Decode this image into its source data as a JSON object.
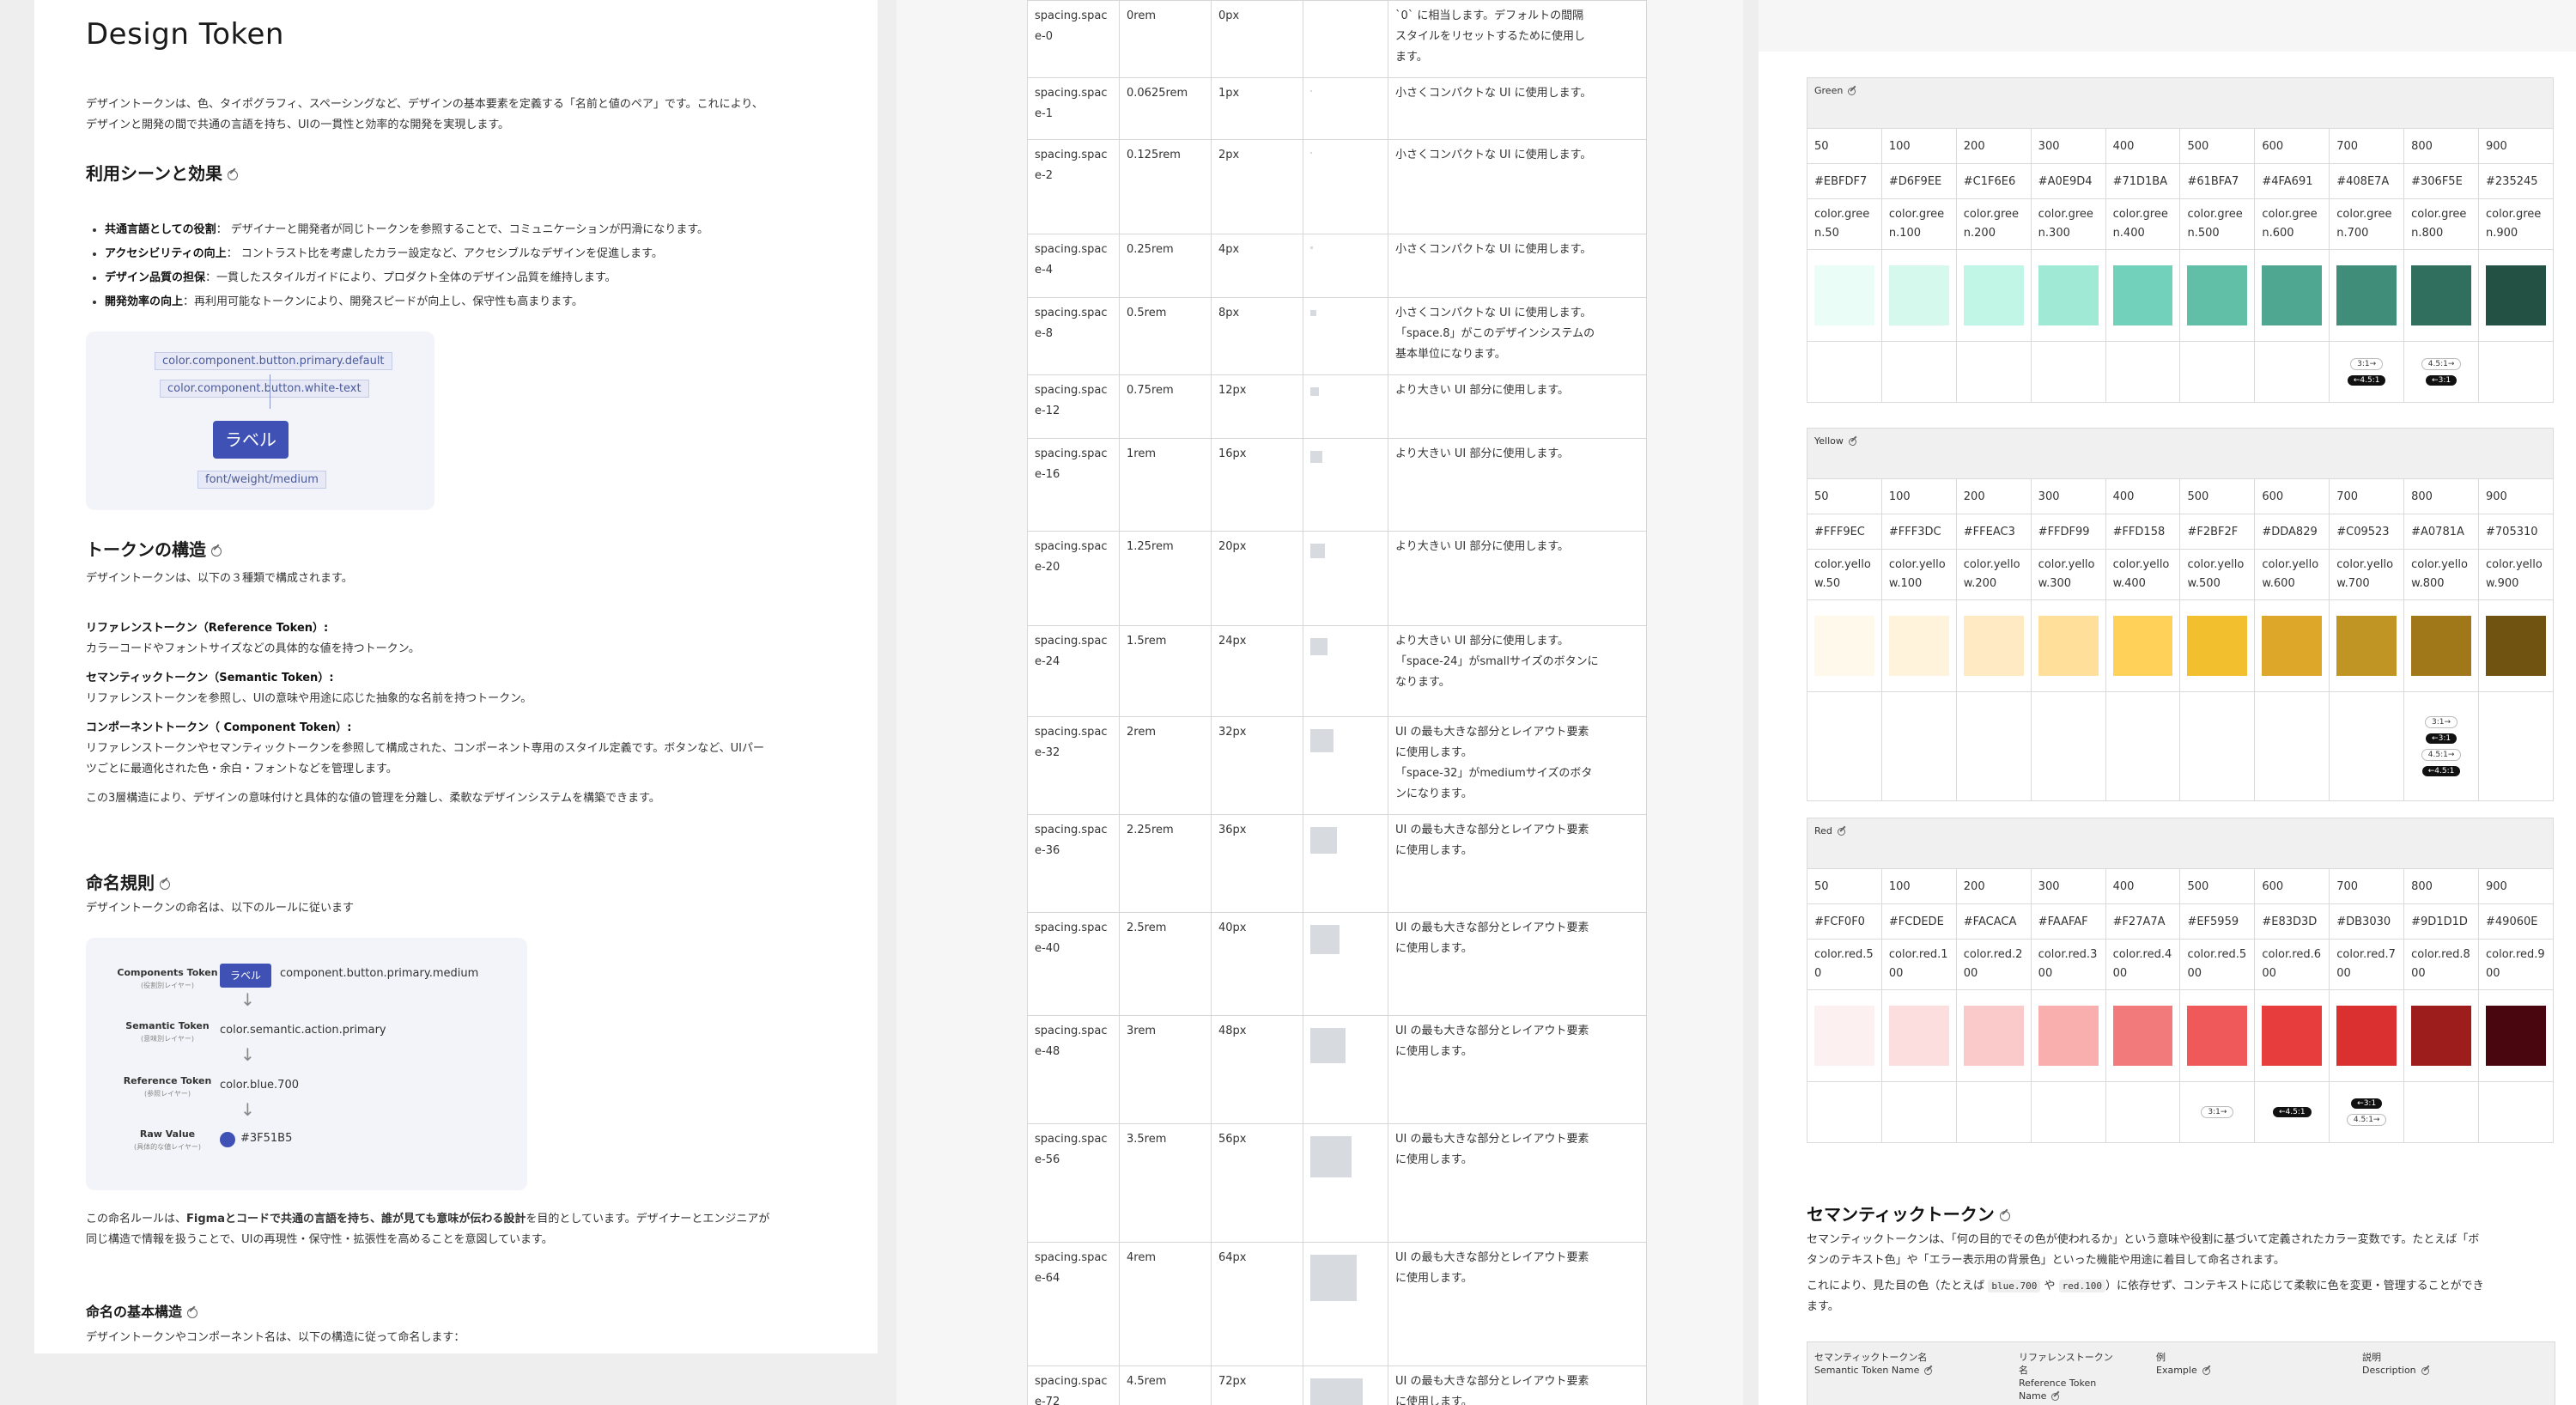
{
  "left": {
    "title": "Design Token",
    "intro_1": "デザイントークンは、色、タイポグラフィ、スペーシングなど、デザインの基本要素を定義する「名前と値のペア」です。これにより、",
    "intro_2": "デザインと開発の間で共通の言語を持ち、UIの一貫性と効率的な開発を実現します。",
    "use_heading": "利用シーンと効果",
    "bullets": [
      {
        "bold": "共通言語としての役割",
        "text": "： デザイナーと開発者が同じトークンを参照することで、コミュニケーションが円滑になります。"
      },
      {
        "bold": "アクセシビリティの向上",
        "text": "： コントラスト比を考慮したカラー設定など、アクセシブルなデザインを促進します。"
      },
      {
        "bold": "デザイン品質の担保",
        "text": "：一貫したスタイルガイドにより、プロダクト全体のデザイン品質を維持します。"
      },
      {
        "bold": "開発効率の向上",
        "text": "：再利用可能なトークンにより、開発スピードが向上し、保守性も高まります。"
      }
    ],
    "fig1": {
      "chip_top": "color.component.button.primary.default",
      "chip_mid": "color.component.button.white-text",
      "button": "ラベル",
      "chip_bottom": "font/weight/medium"
    },
    "structure_heading": "トークンの構造",
    "structure_intro": "デザイントークンは、以下の３種類で構成されます。",
    "ref_term": "リファレンストークン（Reference Token）:",
    "ref_desc": "カラーコードやフォントサイズなどの具体的な値を持つトークン。",
    "sem_term": "セマンティックトークン（Semantic Token）:",
    "sem_desc": "リファレンストークンを参照し、UIの意味や用途に応じた抽象的な名前を持つトークン。",
    "comp_term": "コンポーネントトークン（ Component Token）:",
    "comp_desc_1": "リファレンストークンやセマンティックトークンを参照して構成された、コンポーネント専用のスタイル定義です。ボタンなど、UIパー",
    "comp_desc_2": "ツごとに最適化された色・余白・フォントなどを管理します。",
    "structure_summary": "この3層構造により、デザインの意味付けと具体的な値の管理を分離し、柔軟なデザインシステムを構築できます。",
    "naming_heading": "命名規則",
    "naming_intro": "デザイントークンの命名は、以下のルールに従います",
    "flow": [
      {
        "name": "Components Token",
        "sub": "(役割別レイヤー)",
        "value": "component.button.primary.medium",
        "button": "ラベル"
      },
      {
        "name": "Semantic Token",
        "sub": "(意味別レイヤー)",
        "value": "color.semantic.action.primary"
      },
      {
        "name": "Reference Token",
        "sub": "(参照レイヤー)",
        "value": "color.blue.700"
      },
      {
        "name": "Raw Value",
        "sub": "(具体的な値レイヤー)",
        "value": "#3F51B5"
      }
    ],
    "naming_p1_a": "この命名ルールは、",
    "naming_p1_b": "Figmaとコードで共通の言語を持ち、誰が見ても意味が伝わる設計",
    "naming_p1_c": "を目的としています。デザイナーとエンジニアが",
    "naming_p2": "同じ構造で情報を扱うことで、UIの再現性・保守性・拡張性を高めることを意図しています。",
    "basic_heading": "命名の基本構造",
    "basic_intro": "デザイントークンやコンポーネント名は、以下の構造に従って命名します："
  },
  "spacing": {
    "rows": [
      {
        "name": "spacing.space-0",
        "rem": "0rem",
        "px": "0px",
        "swatch": 0,
        "desc": [
          "`0` に相当します。デフォルトの間隔",
          "スタイルをリセットするために使用し",
          "ます。"
        ]
      },
      {
        "name": "spacing.space-1",
        "rem": "0.0625rem",
        "px": "1px",
        "swatch": 1,
        "desc": [
          "小さくコンパクトな UI に使用します。"
        ]
      },
      {
        "name": "spacing.space-2",
        "rem": "0.125rem",
        "px": "2px",
        "swatch": 2,
        "desc": [
          "小さくコンパクトな UI に使用します。"
        ]
      },
      {
        "name": "spacing.space-4",
        "rem": "0.25rem",
        "px": "4px",
        "swatch": 4,
        "desc": [
          "小さくコンパクトな UI に使用します。"
        ]
      },
      {
        "name": "spacing.space-8",
        "rem": "0.5rem",
        "px": "8px",
        "swatch": 8,
        "desc": [
          "小さくコンパクトな UI に使用します。",
          "「space.8」がこのデザインシステムの",
          "基本単位になります。"
        ]
      },
      {
        "name": "spacing.space-12",
        "rem": "0.75rem",
        "px": "12px",
        "swatch": 12,
        "desc": [
          "より大きい UI 部分に使用します。"
        ]
      },
      {
        "name": "spacing.space-16",
        "rem": "1rem",
        "px": "16px",
        "swatch": 16,
        "desc": [
          "より大きい UI 部分に使用します。"
        ]
      },
      {
        "name": "spacing.space-20",
        "rem": "1.25rem",
        "px": "20px",
        "swatch": 20,
        "desc": [
          "より大きい UI 部分に使用します。"
        ]
      },
      {
        "name": "spacing.space-24",
        "rem": "1.5rem",
        "px": "24px",
        "swatch": 24,
        "desc": [
          "より大きい UI 部分に使用します。",
          "「space-24」がsmallサイズのボタンに",
          "なります。"
        ]
      },
      {
        "name": "spacing.space-32",
        "rem": "2rem",
        "px": "32px",
        "swatch": 32,
        "desc": [
          "UI の最も大きな部分とレイアウト要素",
          "に使用します。",
          "「space-32」がmediumサイズのボタ",
          "ンになります。"
        ]
      },
      {
        "name": "spacing.space-36",
        "rem": "2.25rem",
        "px": "36px",
        "swatch": 36,
        "desc": [
          "UI の最も大きな部分とレイアウト要素",
          "に使用します。"
        ]
      },
      {
        "name": "spacing.space-40",
        "rem": "2.5rem",
        "px": "40px",
        "swatch": 40,
        "desc": [
          "UI の最も大きな部分とレイアウト要素",
          "に使用します。"
        ]
      },
      {
        "name": "spacing.space-48",
        "rem": "3rem",
        "px": "48px",
        "swatch": 48,
        "desc": [
          "UI の最も大きな部分とレイアウト要素",
          "に使用します。"
        ]
      },
      {
        "name": "spacing.space-56",
        "rem": "3.5rem",
        "px": "56px",
        "swatch": 56,
        "desc": [
          "UI の最も大きな部分とレイアウト要素",
          "に使用します。"
        ]
      },
      {
        "name": "spacing.space-64",
        "rem": "4rem",
        "px": "64px",
        "swatch": 64,
        "desc": [
          "UI の最も大きな部分とレイアウト要素",
          "に使用します。"
        ]
      },
      {
        "name": "spacing.space-72",
        "rem": "4.5rem",
        "px": "72px",
        "swatch": 72,
        "desc": [
          "UI の最も大きな部分とレイアウト要素",
          "に使用します。"
        ]
      }
    ]
  },
  "palettes": [
    {
      "id": "green",
      "title": "Green",
      "steps": [
        "50",
        "100",
        "200",
        "300",
        "400",
        "500",
        "600",
        "700",
        "800",
        "900"
      ],
      "hex": [
        "#EBFDF7",
        "#D6F9EE",
        "#C1F6E6",
        "#A0E9D4",
        "#71D1BA",
        "#61BFA7",
        "#4FA691",
        "#408E7A",
        "#306F5E",
        "#235245"
      ],
      "tokens": [
        "color.green.50",
        "color.green.100",
        "color.green.200",
        "color.green.300",
        "color.green.400",
        "color.green.500",
        "color.green.600",
        "color.green.700",
        "color.green.800",
        "color.green.900"
      ],
      "badges": [
        [],
        [],
        [],
        [],
        [],
        [],
        [],
        [
          [
            "3:1→",
            "outline"
          ],
          [
            "←4.5:1",
            "filled"
          ]
        ],
        [
          [
            "4.5:1→",
            "outline"
          ],
          [
            "←3:1",
            "filled"
          ]
        ],
        []
      ]
    },
    {
      "id": "yellow",
      "title": "Yellow",
      "steps": [
        "50",
        "100",
        "200",
        "300",
        "400",
        "500",
        "600",
        "700",
        "800",
        "900"
      ],
      "hex": [
        "#FFF9EC",
        "#FFF3DC",
        "#FFEAC3",
        "#FFDF99",
        "#FFD158",
        "#F2BF2F",
        "#DDA829",
        "#C09523",
        "#A0781A",
        "#705310"
      ],
      "tokens": [
        "color.yellow.50",
        "color.yellow.100",
        "color.yellow.200",
        "color.yellow.300",
        "color.yellow.400",
        "color.yellow.500",
        "color.yellow.600",
        "color.yellow.700",
        "color.yellow.800",
        "color.yellow.900"
      ],
      "badges": [
        [],
        [],
        [],
        [],
        [],
        [],
        [],
        [],
        [
          [
            "3:1→",
            "outline"
          ],
          [
            "←3:1",
            "filled"
          ],
          [
            "4.5:1→",
            "outline"
          ],
          [
            "←4.5:1",
            "filled"
          ]
        ],
        []
      ]
    },
    {
      "id": "red",
      "title": "Red",
      "steps": [
        "50",
        "100",
        "200",
        "300",
        "400",
        "500",
        "600",
        "700",
        "800",
        "900"
      ],
      "hex": [
        "#FCF0F0",
        "#FCDEDE",
        "#FACACA",
        "#FAAFAF",
        "#F27A7A",
        "#EF5959",
        "#E83D3D",
        "#DB3030",
        "#9D1D1D",
        "#49060E"
      ],
      "tokens": [
        "color.red.50",
        "color.red.100",
        "color.red.200",
        "color.red.300",
        "color.red.400",
        "color.red.500",
        "color.red.600",
        "color.red.700",
        "color.red.800",
        "color.red.900"
      ],
      "badges": [
        [],
        [],
        [],
        [],
        [],
        [
          [
            "3:1→",
            "outline"
          ]
        ],
        [
          [
            "←4.5:1",
            "filled"
          ]
        ],
        [
          [
            "←3:1",
            "filled"
          ],
          [
            "4.5:1→",
            "outline"
          ]
        ],
        [],
        []
      ]
    }
  ],
  "semantic": {
    "heading": "セマンティックトークン",
    "p1": "セマンティックトークンは、「何の目的でその色が使われるか」という意味や役割に基づいて定義されたカラー変数です。たとえば「ボ",
    "p2": "タンのテキスト色」や「エラー表示用の背景色」といった機能や用途に着目して命名されます。",
    "p3_a": "これにより、見た目の色（たとえば ",
    "code1": "blue.700",
    "p3_b": " や ",
    "code2": "red.100",
    "p3_c": "）に依存せず、コンテキストに応じて柔軟に色を変更・管理することができ",
    "p4": "ます。",
    "col1_a": "セマンティックトークン名",
    "col1_b": "Semantic Token Name",
    "col2_a": "リファレンストークン",
    "col2_b": "名",
    "col2_c": "Reference Token",
    "col2_d": "Name",
    "col3_a": "例",
    "col3_b": "Example",
    "col4_a": "説明",
    "col4_b": "Description"
  }
}
